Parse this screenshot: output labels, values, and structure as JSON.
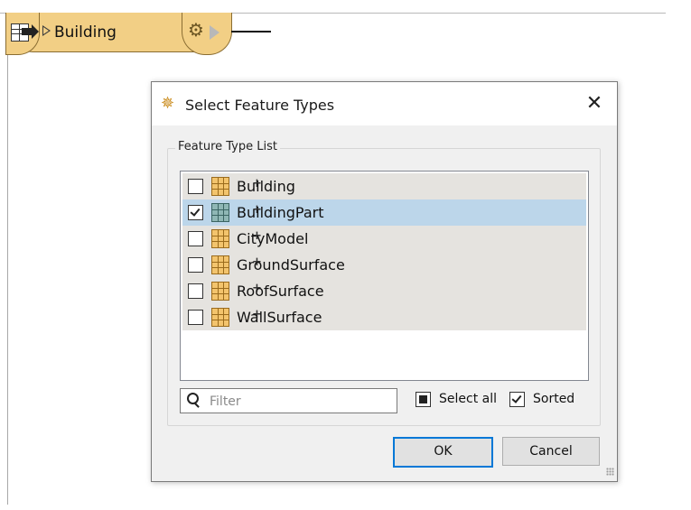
{
  "canvas": {
    "node": {
      "title": "Building",
      "icons": {
        "table": "table-icon",
        "run": "play-triangle-icon",
        "settings": "gear-icon",
        "output_port": "output-port-icon"
      }
    }
  },
  "dialog": {
    "title": "Select Feature Types",
    "title_icon": "fme-workbench-icon",
    "close_glyph": "✕",
    "group_label": "Feature Type List",
    "feature_types": [
      {
        "label": "Building",
        "checked": false,
        "selected": false,
        "icon_color": "#f3c46d"
      },
      {
        "label": "BuildingPart",
        "checked": true,
        "selected": true,
        "icon_color": "#8fb7b5"
      },
      {
        "label": "CityModel",
        "checked": false,
        "selected": false,
        "icon_color": "#f3c46d"
      },
      {
        "label": "GroundSurface",
        "checked": false,
        "selected": false,
        "icon_color": "#f3c46d"
      },
      {
        "label": "RoofSurface",
        "checked": false,
        "selected": false,
        "icon_color": "#f3c46d"
      },
      {
        "label": "WallSurface",
        "checked": false,
        "selected": false,
        "icon_color": "#f3c46d"
      }
    ],
    "filter": {
      "placeholder": "Filter",
      "value": ""
    },
    "select_all_label": "Select all",
    "sorted_label": "Sorted",
    "sorted_checked": true,
    "ok_label": "OK",
    "cancel_label": "Cancel"
  },
  "colors": {
    "accent": "#0078d7",
    "selected_row": "#bcd6ea",
    "row": "#e5e3df",
    "node_fill": "#f2cf85"
  }
}
